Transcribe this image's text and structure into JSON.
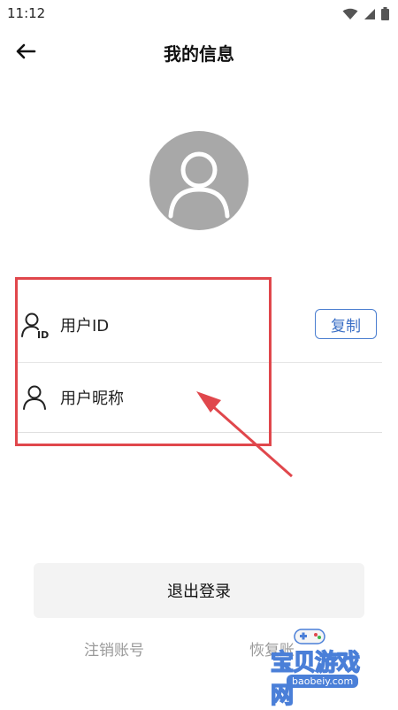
{
  "status_bar": {
    "time": "11:12",
    "icons": [
      "wifi-icon",
      "signal-icon",
      "battery-icon"
    ]
  },
  "header": {
    "title": "我的信息",
    "back_icon": "arrow-left-icon"
  },
  "avatar": {
    "icon": "user-placeholder-icon",
    "bg_color": "#a8a8a8"
  },
  "info_rows": [
    {
      "label": "用户ID",
      "icon": "user-id-icon",
      "action_label": "复制"
    },
    {
      "label": "用户昵称",
      "icon": "user-icon"
    }
  ],
  "logout_button": {
    "label": "退出登录"
  },
  "bottom_links": {
    "cancel_account": "注销账号",
    "restore_account": "恢复账"
  },
  "watermark": {
    "title": "宝贝游戏网",
    "url": "baobeiy.com",
    "icon": "gamepad-icon"
  },
  "annotation": {
    "color": "#e0474c"
  },
  "colors": {
    "accent": "#3b6fc6",
    "logout_bg": "#f3f3f3",
    "muted_text": "#9a9a9a"
  }
}
